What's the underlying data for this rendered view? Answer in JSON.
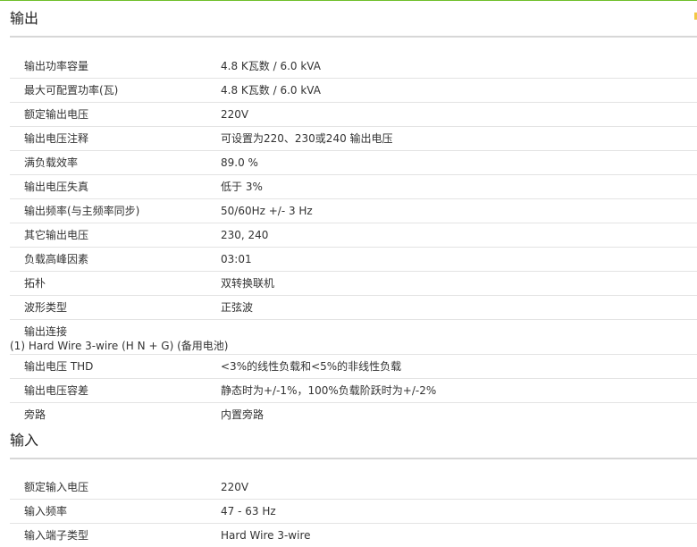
{
  "output": {
    "title": "输出",
    "rows": [
      {
        "label": "输出功率容量",
        "value": "4.8 K瓦数 / 6.0 kVA"
      },
      {
        "label": "最大可配置功率(瓦)",
        "value": "4.8 K瓦数 / 6.0 kVA"
      },
      {
        "label": "额定输出电压",
        "value": "220V"
      },
      {
        "label": "输出电压注释",
        "value": "可设置为220、230或240 输出电压"
      },
      {
        "label": "满负载效率",
        "value": "89.0 %"
      },
      {
        "label": "输出电压失真",
        "value": "低于 3%"
      },
      {
        "label": "输出频率(与主频率同步)",
        "value": "50/60Hz +/- 3 Hz"
      },
      {
        "label": "其它输出电压",
        "value": "230, 240"
      },
      {
        "label": "负载高峰因素",
        "value": "03:01"
      },
      {
        "label": "拓朴",
        "value": "双转换联机"
      },
      {
        "label": "波形类型",
        "value": "正弦波"
      }
    ],
    "connection": {
      "label": "输出连接",
      "value": "(1) Hard Wire 3-wire (H N + G) (备用电池)"
    },
    "rows2": [
      {
        "label": "输出电压 THD",
        "value": "<3%的线性负载和<5%的非线性负载"
      },
      {
        "label": "输出电压容差",
        "value": "静态时为+/-1%，100%负载阶跃时为+/-2%"
      },
      {
        "label": "旁路",
        "value": "内置旁路"
      }
    ]
  },
  "input": {
    "title": "输入",
    "rows": [
      {
        "label": "额定输入电压",
        "value": "220V"
      },
      {
        "label": "输入频率",
        "value": "47 - 63 Hz"
      },
      {
        "label": "输入端子类型",
        "value": "Hard Wire 3-wire"
      }
    ]
  }
}
